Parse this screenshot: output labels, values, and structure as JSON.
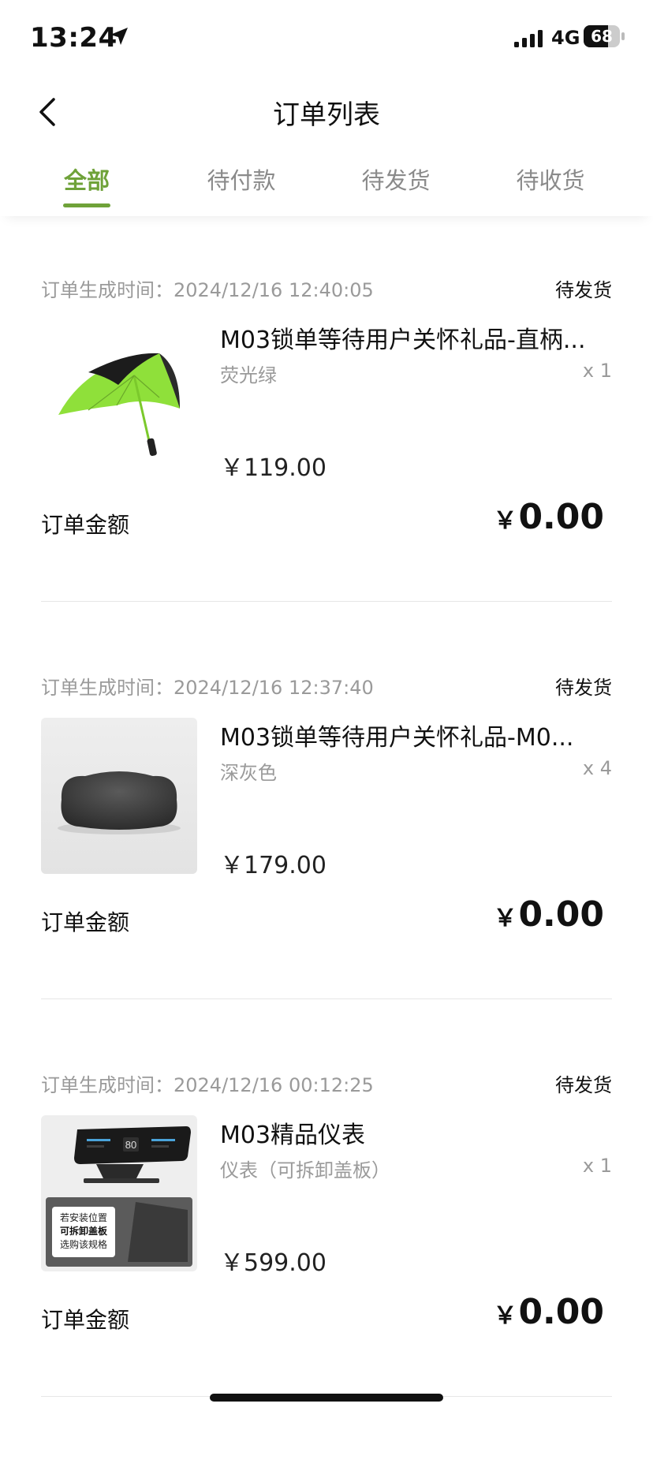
{
  "status_bar": {
    "time": "13:24",
    "network": "4G",
    "battery_level": "68",
    "battery_fraction": 0.68
  },
  "nav": {
    "title": "订单列表",
    "back_icon": "chevron-left-icon"
  },
  "tabs": [
    {
      "label": "全部",
      "active": true
    },
    {
      "label": "待付款",
      "active": false
    },
    {
      "label": "待发货",
      "active": false
    },
    {
      "label": "待收货",
      "active": false
    }
  ],
  "orders": [
    {
      "meta": "订单生成时间：2024/12/16 12:40:05",
      "status": "待发货",
      "product_name": "M03锁单等待用户关怀礼品-直柄...",
      "variant": "荧光绿",
      "qty": "x 1",
      "price": "￥119.00",
      "total_label": "订单金额",
      "currency": "￥",
      "total": "0.00",
      "thumb_icon": "umbrella-image"
    },
    {
      "meta": "订单生成时间：2024/12/16 12:37:40",
      "status": "待发货",
      "product_name": "M03锁单等待用户关怀礼品-M0...",
      "variant": "深灰色",
      "qty": "x 4",
      "price": "￥179.00",
      "total_label": "订单金额",
      "currency": "￥",
      "total": "0.00",
      "thumb_icon": "neck-pillow-image"
    },
    {
      "meta": "订单生成时间：2024/12/16 00:12:25",
      "status": "待发货",
      "product_name": "M03精品仪表",
      "variant": "仪表（可拆卸盖板）",
      "qty": "x 1",
      "price": "￥599.00",
      "total_label": "订单金额",
      "currency": "￥",
      "total": "0.00",
      "thumb_icon": "dashboard-display-image",
      "thumb_caption": [
        "若安装位置",
        "可拆卸盖板",
        "选购该规格"
      ],
      "thumb_display_value": "80"
    }
  ],
  "colors": {
    "accent": "#6fa239",
    "muted_text": "#9a9a9a",
    "umbrella_green": "#8fe03a"
  }
}
